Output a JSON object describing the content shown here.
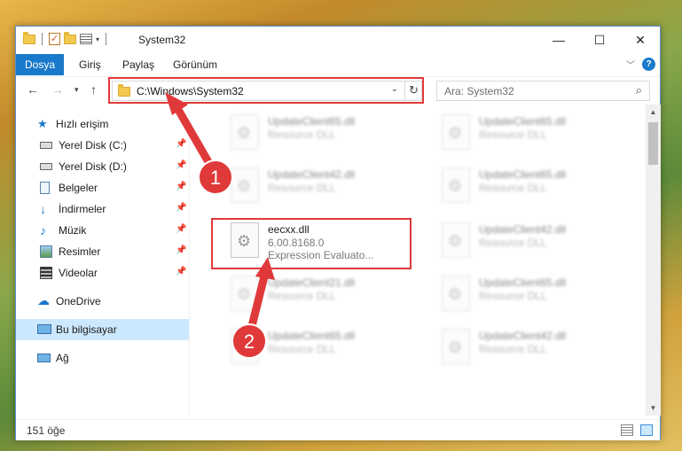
{
  "window": {
    "title": "System32",
    "controls": {
      "minimize": "—",
      "maximize": "☐",
      "close": "✕"
    }
  },
  "ribbon": {
    "tabs": [
      "Dosya",
      "Giriş",
      "Paylaş",
      "Görünüm"
    ],
    "help": "?"
  },
  "address": {
    "path": "C:\\Windows\\System32",
    "search_placeholder": "Ara: System32"
  },
  "sidebar": {
    "quick_access": "Hızlı erişim",
    "items": [
      {
        "label": "Yerel Disk (C:)",
        "icon": "drive-icon",
        "pinned": true
      },
      {
        "label": "Yerel Disk (D:)",
        "icon": "drive-icon",
        "pinned": true
      },
      {
        "label": "Belgeler",
        "icon": "documents-icon",
        "pinned": true
      },
      {
        "label": "İndirmeler",
        "icon": "download-icon",
        "pinned": true
      },
      {
        "label": "Müzik",
        "icon": "music-icon",
        "pinned": true
      },
      {
        "label": "Resimler",
        "icon": "pictures-icon",
        "pinned": true
      },
      {
        "label": "Videolar",
        "icon": "videos-icon",
        "pinned": true
      }
    ],
    "onedrive": "OneDrive",
    "this_pc": "Bu bilgisayar",
    "network": "Ağ"
  },
  "files": {
    "highlighted": {
      "name": "eecxx.dll",
      "version": "6.00.8168.0",
      "description": "Expression Evaluato..."
    },
    "left_column": [
      {
        "name": "UpdateClient65.dll",
        "type": "Resource DLL"
      },
      {
        "name": "UpdateClient42.dll",
        "type": "Resource DLL"
      },
      {
        "name": "UpdateClient21.dll",
        "type": "Resource DLL"
      },
      {
        "name": "UpdateClient65.dll",
        "type": "Resource DLL"
      }
    ],
    "right_column": [
      {
        "name": "UpdateClient65.dll",
        "type": "Resource DLL"
      },
      {
        "name": "UpdateClient65.dll",
        "type": "Resource DLL"
      },
      {
        "name": "UpdateClient42.dll",
        "type": "Resource DLL"
      },
      {
        "name": "UpdateClient65.dll",
        "type": "Resource DLL"
      },
      {
        "name": "UpdateClient42.dll",
        "type": "Resource DLL"
      }
    ]
  },
  "status": {
    "count": "151 öğe"
  },
  "annotations": {
    "step1": "1",
    "step2": "2"
  },
  "colors": {
    "accent": "#1979ca",
    "annotation_red": "#e0393a",
    "selection": "#cce8ff"
  }
}
